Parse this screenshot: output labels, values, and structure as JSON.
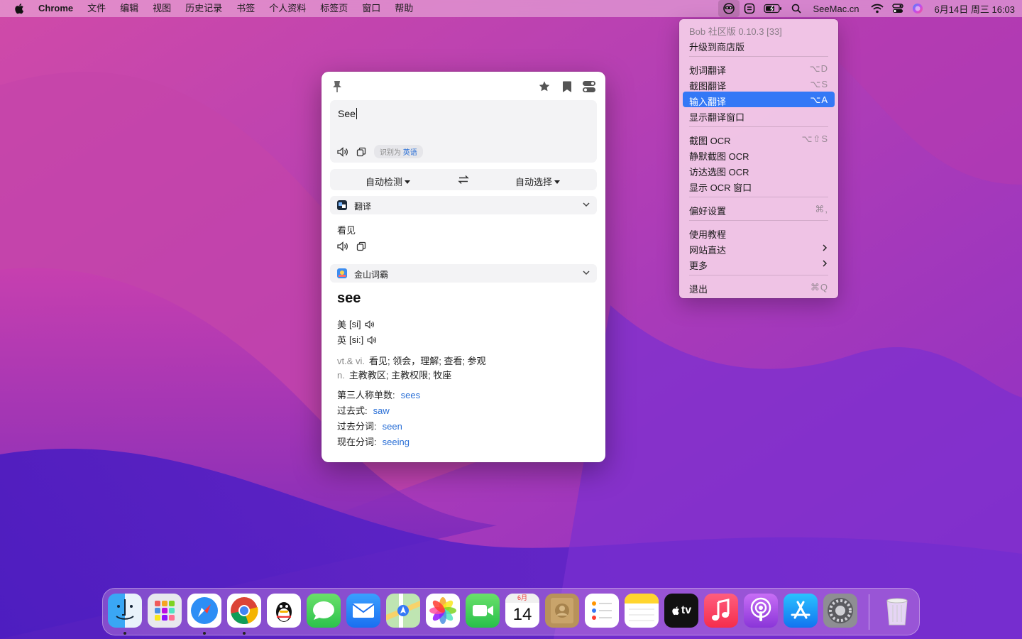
{
  "menubar": {
    "app_name": "Chrome",
    "items": [
      "文件",
      "编辑",
      "视图",
      "历史记录",
      "书签",
      "个人资料",
      "标签页",
      "窗口",
      "帮助"
    ],
    "status_text": "SeeMac.cn",
    "clock": "6月14日 周三  16:03"
  },
  "bob": {
    "input_text": "See",
    "detect_prefix": "识别为",
    "detect_lang": "英语",
    "from_lang": "自动检测",
    "to_lang": "自动选择",
    "services": [
      {
        "name": "翻译",
        "result": "看见"
      },
      {
        "name": "金山词霸"
      }
    ],
    "dict": {
      "word": "see",
      "us_label": "美",
      "us_phonetic": "[si]",
      "uk_label": "英",
      "uk_phonetic": "[si:]",
      "defs": [
        {
          "pos": "vt.& vi.",
          "meaning": "看见; 领会，理解; 查看; 参观"
        },
        {
          "pos": "n.",
          "meaning": "主教教区; 主教权限; 牧座"
        }
      ],
      "forms": [
        {
          "label": "第三人称单数:",
          "value": "sees"
        },
        {
          "label": "过去式:",
          "value": "saw"
        },
        {
          "label": "过去分词:",
          "value": "seen"
        },
        {
          "label": "现在分词:",
          "value": "seeing"
        }
      ]
    }
  },
  "menu": {
    "items": [
      {
        "label": "Bob 社区版 0.10.3 [33]",
        "shortcut": "",
        "disabled": true
      },
      {
        "label": "升级到商店版",
        "shortcut": ""
      },
      {
        "label": "划词翻译",
        "shortcut": "⌥D"
      },
      {
        "label": "截图翻译",
        "shortcut": "⌥S"
      },
      {
        "label": "输入翻译",
        "shortcut": "⌥A",
        "active": true
      },
      {
        "label": "显示翻译窗口",
        "shortcut": ""
      },
      {
        "label": "截图 OCR",
        "shortcut": "⌥⇧S"
      },
      {
        "label": "静默截图 OCR",
        "shortcut": ""
      },
      {
        "label": "访达选图 OCR",
        "shortcut": ""
      },
      {
        "label": "显示 OCR 窗口",
        "shortcut": ""
      },
      {
        "label": "偏好设置",
        "shortcut": "⌘,"
      },
      {
        "label": "使用教程",
        "shortcut": ""
      },
      {
        "label": "网站直达",
        "shortcut": "",
        "submenu": true
      },
      {
        "label": "更多",
        "shortcut": "",
        "submenu": true
      },
      {
        "label": "退出",
        "shortcut": "⌘Q"
      }
    ]
  },
  "dock": {
    "apps": [
      "finder",
      "launchpad",
      "safari",
      "chrome",
      "qq",
      "messages",
      "mail",
      "maps",
      "photos",
      "facetime",
      "calendar",
      "contacts",
      "reminders",
      "notes",
      "tv",
      "music",
      "podcasts",
      "app-store",
      "system-preferences",
      "trash"
    ],
    "calendar_month": "6月",
    "calendar_day": "14",
    "tv_label": "tv"
  },
  "colors": {
    "accent": "#3478f6",
    "link": "#2a6fd6"
  }
}
